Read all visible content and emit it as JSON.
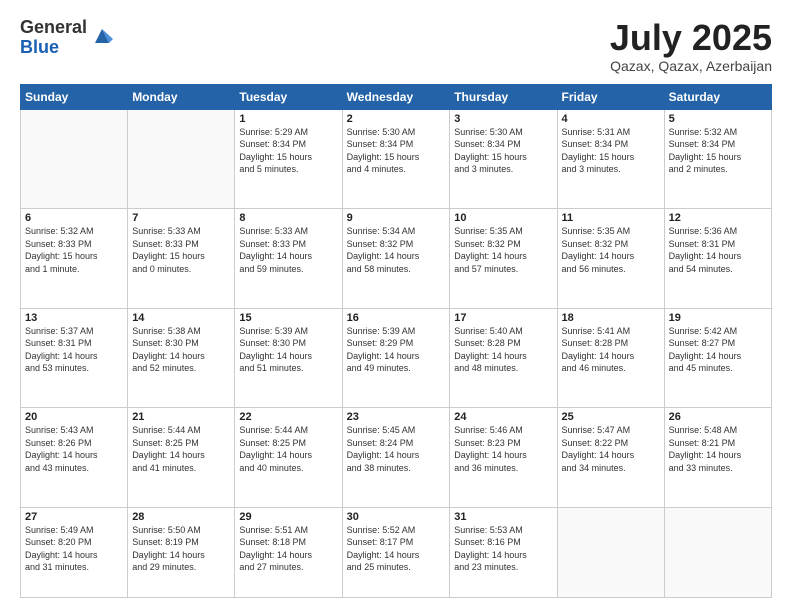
{
  "logo": {
    "general": "General",
    "blue": "Blue"
  },
  "title": "July 2025",
  "location": "Qazax, Qazax, Azerbaijan",
  "days_header": [
    "Sunday",
    "Monday",
    "Tuesday",
    "Wednesday",
    "Thursday",
    "Friday",
    "Saturday"
  ],
  "weeks": [
    [
      {
        "day": "",
        "info": ""
      },
      {
        "day": "",
        "info": ""
      },
      {
        "day": "1",
        "info": "Sunrise: 5:29 AM\nSunset: 8:34 PM\nDaylight: 15 hours\nand 5 minutes."
      },
      {
        "day": "2",
        "info": "Sunrise: 5:30 AM\nSunset: 8:34 PM\nDaylight: 15 hours\nand 4 minutes."
      },
      {
        "day": "3",
        "info": "Sunrise: 5:30 AM\nSunset: 8:34 PM\nDaylight: 15 hours\nand 3 minutes."
      },
      {
        "day": "4",
        "info": "Sunrise: 5:31 AM\nSunset: 8:34 PM\nDaylight: 15 hours\nand 3 minutes."
      },
      {
        "day": "5",
        "info": "Sunrise: 5:32 AM\nSunset: 8:34 PM\nDaylight: 15 hours\nand 2 minutes."
      }
    ],
    [
      {
        "day": "6",
        "info": "Sunrise: 5:32 AM\nSunset: 8:33 PM\nDaylight: 15 hours\nand 1 minute."
      },
      {
        "day": "7",
        "info": "Sunrise: 5:33 AM\nSunset: 8:33 PM\nDaylight: 15 hours\nand 0 minutes."
      },
      {
        "day": "8",
        "info": "Sunrise: 5:33 AM\nSunset: 8:33 PM\nDaylight: 14 hours\nand 59 minutes."
      },
      {
        "day": "9",
        "info": "Sunrise: 5:34 AM\nSunset: 8:32 PM\nDaylight: 14 hours\nand 58 minutes."
      },
      {
        "day": "10",
        "info": "Sunrise: 5:35 AM\nSunset: 8:32 PM\nDaylight: 14 hours\nand 57 minutes."
      },
      {
        "day": "11",
        "info": "Sunrise: 5:35 AM\nSunset: 8:32 PM\nDaylight: 14 hours\nand 56 minutes."
      },
      {
        "day": "12",
        "info": "Sunrise: 5:36 AM\nSunset: 8:31 PM\nDaylight: 14 hours\nand 54 minutes."
      }
    ],
    [
      {
        "day": "13",
        "info": "Sunrise: 5:37 AM\nSunset: 8:31 PM\nDaylight: 14 hours\nand 53 minutes."
      },
      {
        "day": "14",
        "info": "Sunrise: 5:38 AM\nSunset: 8:30 PM\nDaylight: 14 hours\nand 52 minutes."
      },
      {
        "day": "15",
        "info": "Sunrise: 5:39 AM\nSunset: 8:30 PM\nDaylight: 14 hours\nand 51 minutes."
      },
      {
        "day": "16",
        "info": "Sunrise: 5:39 AM\nSunset: 8:29 PM\nDaylight: 14 hours\nand 49 minutes."
      },
      {
        "day": "17",
        "info": "Sunrise: 5:40 AM\nSunset: 8:28 PM\nDaylight: 14 hours\nand 48 minutes."
      },
      {
        "day": "18",
        "info": "Sunrise: 5:41 AM\nSunset: 8:28 PM\nDaylight: 14 hours\nand 46 minutes."
      },
      {
        "day": "19",
        "info": "Sunrise: 5:42 AM\nSunset: 8:27 PM\nDaylight: 14 hours\nand 45 minutes."
      }
    ],
    [
      {
        "day": "20",
        "info": "Sunrise: 5:43 AM\nSunset: 8:26 PM\nDaylight: 14 hours\nand 43 minutes."
      },
      {
        "day": "21",
        "info": "Sunrise: 5:44 AM\nSunset: 8:25 PM\nDaylight: 14 hours\nand 41 minutes."
      },
      {
        "day": "22",
        "info": "Sunrise: 5:44 AM\nSunset: 8:25 PM\nDaylight: 14 hours\nand 40 minutes."
      },
      {
        "day": "23",
        "info": "Sunrise: 5:45 AM\nSunset: 8:24 PM\nDaylight: 14 hours\nand 38 minutes."
      },
      {
        "day": "24",
        "info": "Sunrise: 5:46 AM\nSunset: 8:23 PM\nDaylight: 14 hours\nand 36 minutes."
      },
      {
        "day": "25",
        "info": "Sunrise: 5:47 AM\nSunset: 8:22 PM\nDaylight: 14 hours\nand 34 minutes."
      },
      {
        "day": "26",
        "info": "Sunrise: 5:48 AM\nSunset: 8:21 PM\nDaylight: 14 hours\nand 33 minutes."
      }
    ],
    [
      {
        "day": "27",
        "info": "Sunrise: 5:49 AM\nSunset: 8:20 PM\nDaylight: 14 hours\nand 31 minutes."
      },
      {
        "day": "28",
        "info": "Sunrise: 5:50 AM\nSunset: 8:19 PM\nDaylight: 14 hours\nand 29 minutes."
      },
      {
        "day": "29",
        "info": "Sunrise: 5:51 AM\nSunset: 8:18 PM\nDaylight: 14 hours\nand 27 minutes."
      },
      {
        "day": "30",
        "info": "Sunrise: 5:52 AM\nSunset: 8:17 PM\nDaylight: 14 hours\nand 25 minutes."
      },
      {
        "day": "31",
        "info": "Sunrise: 5:53 AM\nSunset: 8:16 PM\nDaylight: 14 hours\nand 23 minutes."
      },
      {
        "day": "",
        "info": ""
      },
      {
        "day": "",
        "info": ""
      }
    ]
  ]
}
